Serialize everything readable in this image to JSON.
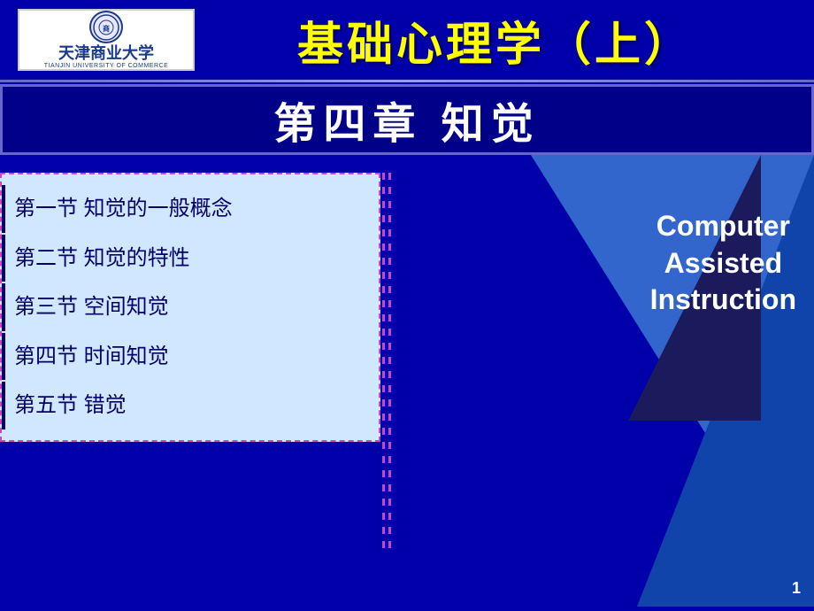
{
  "header": {
    "logo": {
      "name_cn": "天津商业大学",
      "name_en": "TIANJIN UNIVERSITY OF COMMERCE"
    },
    "title": "基础心理学（上）"
  },
  "chapter": {
    "title": "第四章  知觉"
  },
  "menu": {
    "items": [
      {
        "id": 1,
        "label": "第一节  知觉的一般概念"
      },
      {
        "id": 2,
        "label": "第二节  知觉的特性"
      },
      {
        "id": 3,
        "label": "第三节  空间知觉"
      },
      {
        "id": 4,
        "label": "第四节  时间知觉"
      },
      {
        "id": 5,
        "label": "第五节  错觉"
      }
    ]
  },
  "cai": {
    "line1": "Computer",
    "line2": "Assisted",
    "line3": "Instruction"
  },
  "page": {
    "number": "1"
  }
}
